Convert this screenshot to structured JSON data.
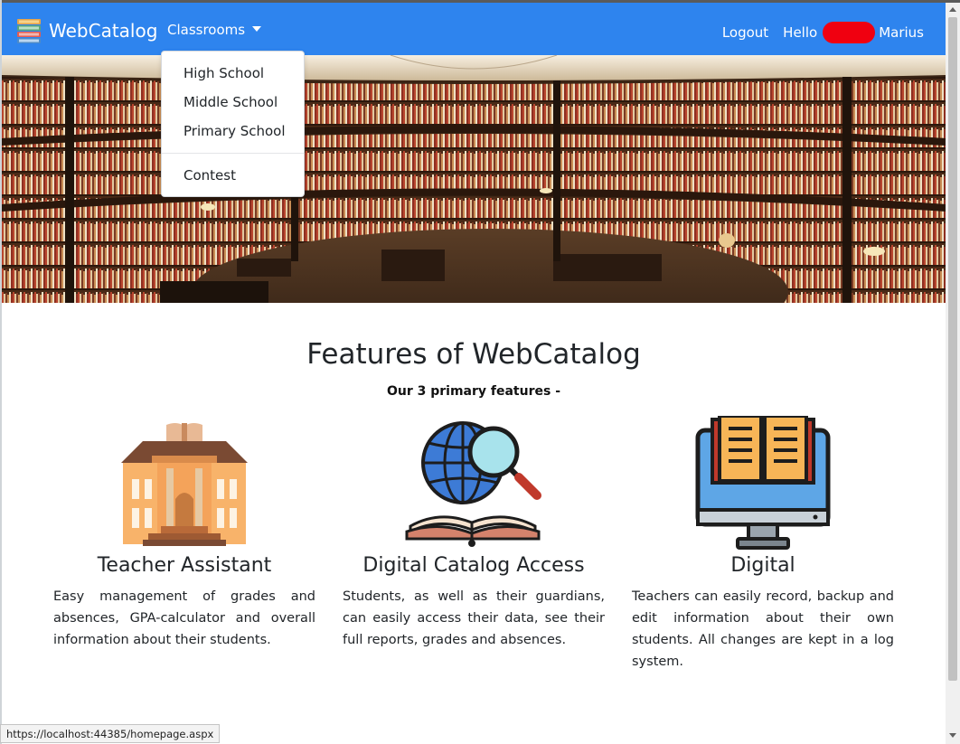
{
  "navbar": {
    "brand": "WebCatalog",
    "classrooms_label": "Classrooms",
    "logout_label": "Logout",
    "hello_label": "Hello",
    "user_name": "Marius",
    "color": "#2e84ee"
  },
  "dropdown": {
    "items": [
      "High School",
      "Middle School",
      "Primary School"
    ],
    "extra_item": "Contest"
  },
  "features": {
    "title": "Features of WebCatalog",
    "subtitle": "Our 3 primary features -",
    "items": [
      {
        "icon": "school-building-icon",
        "title": "Teacher Assistant",
        "text": "Easy management of grades and absences, GPA-calculator and overall information about their students."
      },
      {
        "icon": "globe-magnifier-book-icon",
        "title": "Digital Catalog Access",
        "text": "Students, as well as their guardians, can easily access their data, see their full reports, grades and absences."
      },
      {
        "icon": "monitor-book-icon",
        "title": "Digital",
        "text": "Teachers can easily record, backup and edit information about their own students. All changes are kept in a log system."
      }
    ]
  },
  "status_bar": {
    "url": "https://localhost:44385/homepage.aspx"
  }
}
